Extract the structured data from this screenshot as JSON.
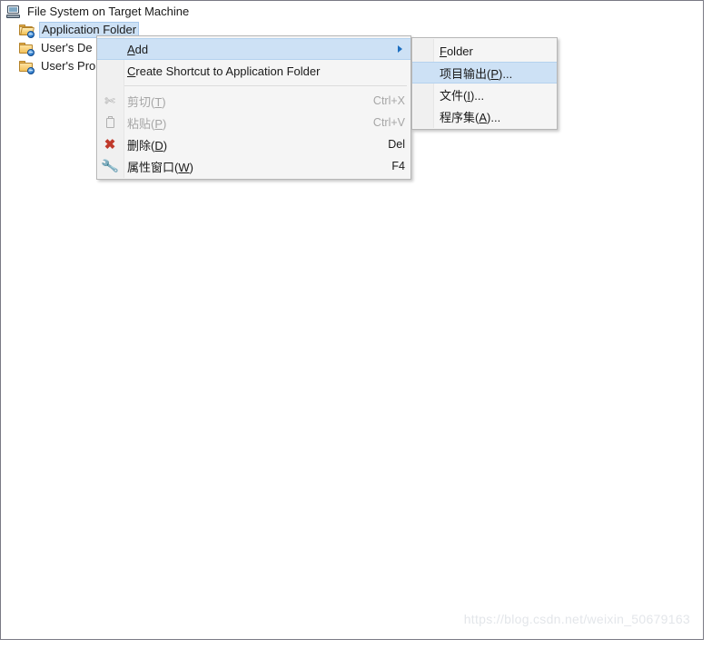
{
  "window": {
    "title": "File System on Target Machine",
    "title_icon": "computer-icon"
  },
  "tree": {
    "items": [
      {
        "label": "Application Folder",
        "icon": "folder-open-shortcut-icon",
        "selected": true
      },
      {
        "label": "User's De",
        "icon": "folder-shortcut-icon",
        "selected": false
      },
      {
        "label": "User's Pro",
        "icon": "folder-shortcut-icon",
        "selected": false
      }
    ]
  },
  "context_menu": {
    "items": [
      {
        "label": "Add",
        "accel": "A",
        "shortcut": "",
        "icon": "",
        "disabled": false,
        "highlight": true,
        "submenu": true
      },
      {
        "label": "Create Shortcut to Application Folder",
        "accel": "C",
        "shortcut": "",
        "icon": "",
        "disabled": false,
        "highlight": false,
        "submenu": false
      },
      {
        "separator": true
      },
      {
        "label": "剪切(T)",
        "accel": "T",
        "shortcut": "Ctrl+X",
        "icon": "scissors-icon",
        "disabled": true,
        "highlight": false,
        "submenu": false
      },
      {
        "label": "粘贴(P)",
        "accel": "P",
        "shortcut": "Ctrl+V",
        "icon": "clipboard-icon",
        "disabled": true,
        "highlight": false,
        "submenu": false
      },
      {
        "label": "删除(D)",
        "accel": "D",
        "shortcut": "Del",
        "icon": "delete-x-icon",
        "disabled": false,
        "highlight": false,
        "submenu": false
      },
      {
        "label": "属性窗口(W)",
        "accel": "W",
        "shortcut": "F4",
        "icon": "wrench-icon",
        "disabled": false,
        "highlight": false,
        "submenu": false
      }
    ]
  },
  "submenu": {
    "items": [
      {
        "label": "Folder",
        "accel": "F",
        "highlight": false
      },
      {
        "label": "项目输出(P)...",
        "accel": "P",
        "highlight": true
      },
      {
        "label": "文件(I)...",
        "accel": "I",
        "highlight": false
      },
      {
        "label": "程序集(A)...",
        "accel": "A",
        "highlight": false
      }
    ]
  },
  "watermark": {
    "text": "https://blog.csdn.net/weixin_50679163"
  },
  "colors": {
    "selection": "#cde1f5",
    "menu_bg": "#f5f5f5",
    "accent_arrow": "#1e6fc0",
    "delete_red": "#c0392b"
  }
}
